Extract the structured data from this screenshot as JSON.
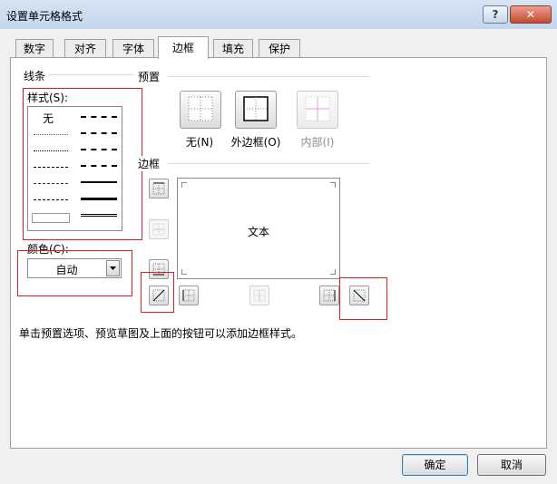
{
  "window": {
    "title": "设置单元格格式",
    "help_label": "?",
    "close_label": "✕"
  },
  "tabs": [
    {
      "label": "数字",
      "active": false
    },
    {
      "label": "对齐",
      "active": false
    },
    {
      "label": "字体",
      "active": false
    },
    {
      "label": "边框",
      "active": true
    },
    {
      "label": "填充",
      "active": false
    },
    {
      "label": "保护",
      "active": false
    }
  ],
  "line_section": {
    "title": "线条",
    "style_label": "样式(S):",
    "none_label": "无",
    "color_label": "颜色(C):",
    "color_value": "自动"
  },
  "preset_section": {
    "title": "预置",
    "presets": [
      {
        "label": "无(N)",
        "icon": "preset-none-icon",
        "enabled": true
      },
      {
        "label": "外边框(O)",
        "icon": "preset-outline-icon",
        "enabled": true
      },
      {
        "label": "内部(I)",
        "icon": "preset-inside-icon",
        "enabled": false
      }
    ]
  },
  "border_section": {
    "title": "边框",
    "preview_text": "文本"
  },
  "hint": "单击预置选项、预览草图及上面的按钮可以添加边框样式。",
  "buttons": {
    "ok": "确定",
    "cancel": "取消"
  },
  "colors": {
    "highlight": "#e02020",
    "disabled_icon": "#d8a0d8"
  }
}
